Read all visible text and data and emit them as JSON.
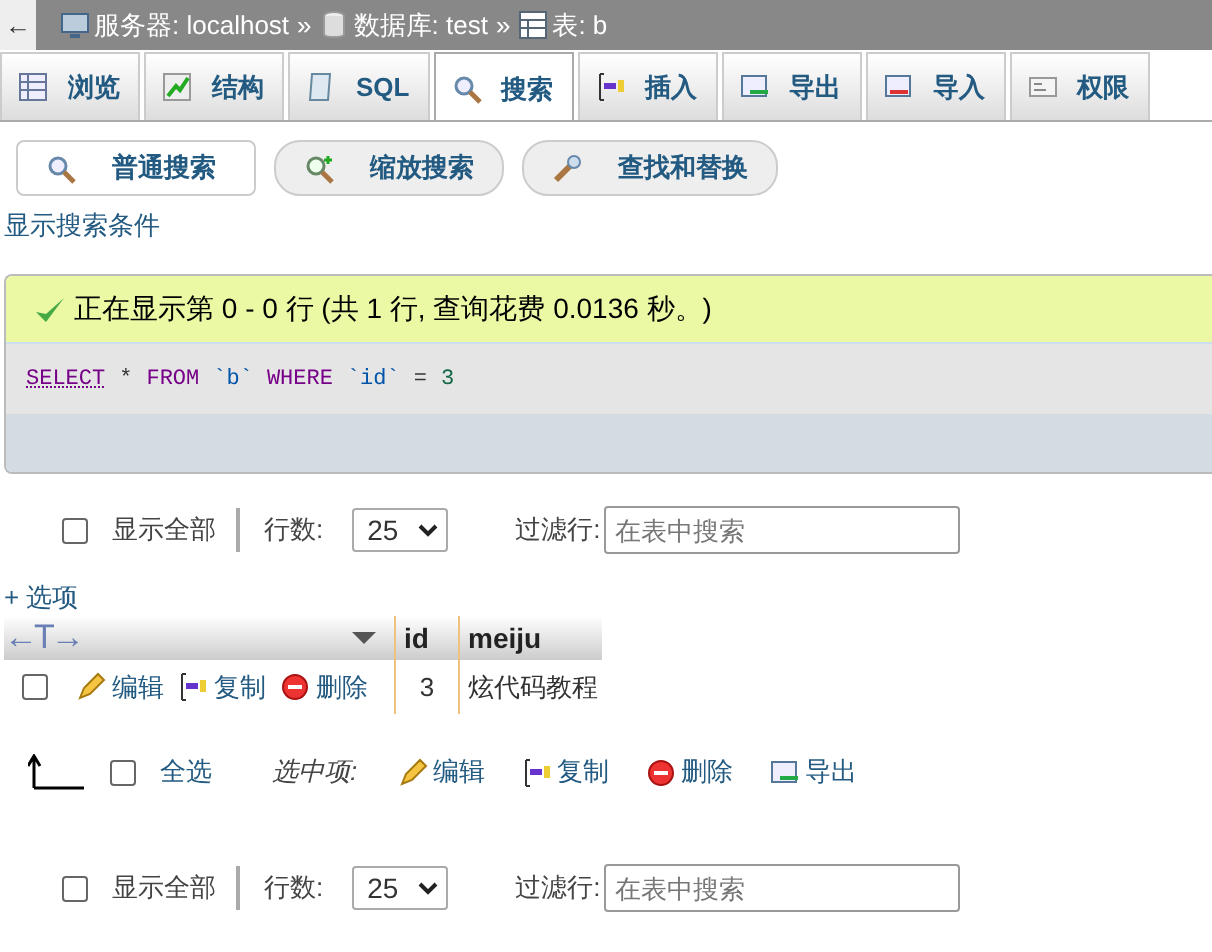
{
  "breadcrumb": {
    "back": "←",
    "items": [
      {
        "kind": "server",
        "label": "服务器: localhost",
        "separator": "»"
      },
      {
        "kind": "database",
        "label": "数据库: test",
        "separator": "»"
      },
      {
        "kind": "table",
        "label": "表: b"
      }
    ]
  },
  "tabs": [
    {
      "kind": "browse",
      "label": "浏览",
      "selected": false
    },
    {
      "kind": "structure",
      "label": "结构",
      "selected": false
    },
    {
      "kind": "sql",
      "label": "SQL",
      "selected": false
    },
    {
      "kind": "search",
      "label": "搜索",
      "selected": true
    },
    {
      "kind": "insert",
      "label": "插入",
      "selected": false
    },
    {
      "kind": "export",
      "label": "导出",
      "selected": false
    },
    {
      "kind": "import",
      "label": "导入",
      "selected": false
    },
    {
      "kind": "privileges",
      "label": "权限",
      "selected": false
    }
  ],
  "subtabs": [
    {
      "kind": "search",
      "label": "普通搜索",
      "selected": true
    },
    {
      "kind": "zoom",
      "label": "缩放搜索",
      "selected": false
    },
    {
      "kind": "replace",
      "label": "查找和替换",
      "selected": false
    }
  ],
  "show_criteria": "显示搜索条件",
  "message": "正在显示第 0 - 0 行 (共 1 行, 查询花费 0.0136 秒。)",
  "sql": [
    {
      "kind": "keyword",
      "text": "SELECT"
    },
    {
      "kind": "operator",
      "text": "*"
    },
    {
      "kind": "keyword",
      "text": "FROM"
    },
    {
      "kind": "identifier",
      "text": "`b`"
    },
    {
      "kind": "keyword",
      "text": "WHERE"
    },
    {
      "kind": "identifier",
      "text": "`id`"
    },
    {
      "kind": "operator",
      "text": "="
    },
    {
      "kind": "number",
      "text": "3"
    }
  ],
  "navs": [
    {
      "show_all": "显示全部",
      "checked": false,
      "rows_label": "行数:",
      "rows_value": "25",
      "filter_label": "过滤行:",
      "placeholder": "在表中搜索"
    },
    {
      "show_all": "显示全部",
      "checked": false,
      "rows_label": "行数:",
      "rows_value": "25",
      "filter_label": "过滤行:",
      "placeholder": "在表中搜索"
    }
  ],
  "options_link": "+ 选项",
  "table": {
    "column_toggle": "←T→",
    "columns": [
      "id",
      "meiju"
    ],
    "rows": [
      {
        "checked": false,
        "actions": [
          {
            "kind": "edit",
            "label": "编辑"
          },
          {
            "kind": "copy",
            "label": "复制"
          },
          {
            "kind": "delete",
            "label": "删除"
          }
        ],
        "cells": [
          "3",
          "炫代码教程"
        ]
      }
    ]
  },
  "bulk": {
    "select_all": "全选",
    "checked": false,
    "with_selected": "选中项:",
    "actions": [
      {
        "kind": "edit",
        "label": "编辑"
      },
      {
        "kind": "copy",
        "label": "复制"
      },
      {
        "kind": "delete",
        "label": "删除"
      },
      {
        "kind": "export",
        "label": "导出"
      }
    ]
  }
}
